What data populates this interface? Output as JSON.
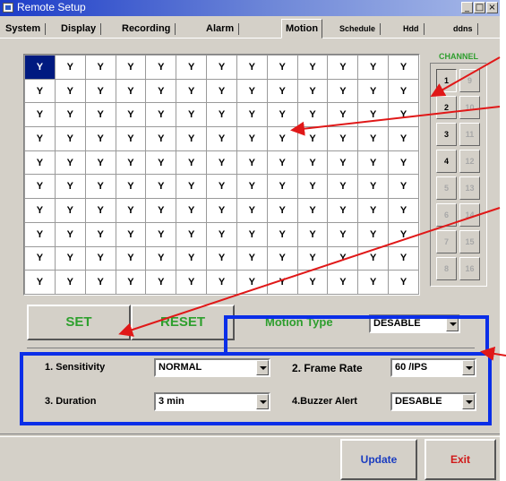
{
  "window": {
    "title": "Remote Setup",
    "min": "_",
    "max": "□",
    "close": "×"
  },
  "tabs": [
    "System",
    "Display",
    "Recording",
    "Alarm",
    "Motion",
    "Schedule",
    "Hdd",
    "ddns"
  ],
  "active_tab": "Motion",
  "grid": {
    "cell": "Y",
    "rows": 10,
    "cols": 13
  },
  "channel": {
    "label": "CHANNEL",
    "left": [
      "1",
      "2",
      "3",
      "4",
      "5",
      "6",
      "7",
      "8"
    ],
    "right": [
      "9",
      "10",
      "11",
      "12",
      "13",
      "14",
      "15",
      "16"
    ]
  },
  "buttons": {
    "set": "SET",
    "reset": "RESET",
    "update": "Update",
    "exit": "Exit"
  },
  "motion_type": {
    "label": "Motion Type",
    "value": "DESABLE"
  },
  "settings": {
    "sensitivity_label": "1. Sensitivity",
    "sensitivity_value": "NORMAL",
    "frame_rate_label": "2. Frame Rate",
    "frame_rate_value": "60 /IPS",
    "duration_label": "3. Duration",
    "duration_value": "3   min",
    "buzzer_label": "4.Buzzer Alert",
    "buzzer_value": "DESABLE"
  },
  "colors": {
    "annotation_blue": "#0a2ee8",
    "annotation_red": "#e01818",
    "label_green": "#2e9e2e",
    "selected_cell": "#001a80"
  }
}
